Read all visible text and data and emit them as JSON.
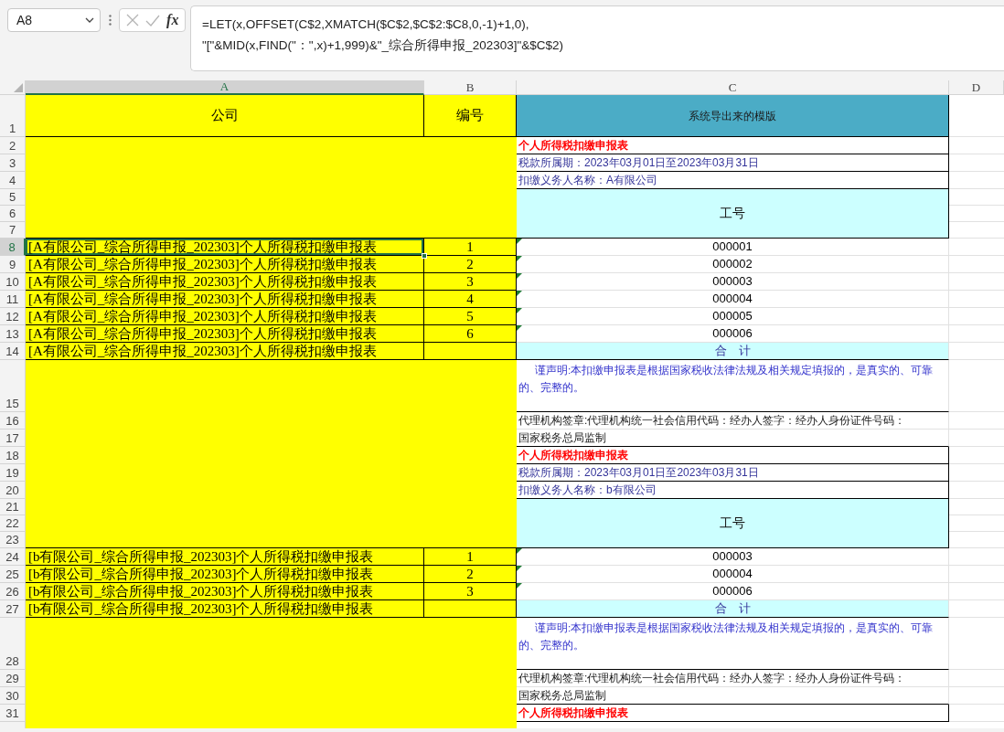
{
  "formula_bar": {
    "name_box": "A8",
    "buttons": [
      {
        "kind": "cancel",
        "disabled": true
      },
      {
        "kind": "enter",
        "disabled": true
      },
      {
        "kind": "function",
        "label": "fx",
        "disabled": false
      }
    ],
    "formula": "=LET(x,OFFSET(C$2,XMATCH($C$2,$C$2:$C8,0,-1)+1,0),\n\"[\"&MID(x,FIND(\"：\",x)+1,999)&\"_综合所得申报_202303]\"&$C$2)"
  },
  "columns": [
    {
      "label": "A",
      "selected": true
    },
    {
      "label": "B",
      "selected": false
    },
    {
      "label": "C",
      "selected": false
    },
    {
      "label": "D",
      "selected": false
    }
  ],
  "rows": [
    {
      "label": "1",
      "selected": false
    },
    {
      "label": "2",
      "selected": false
    },
    {
      "label": "3",
      "selected": false
    },
    {
      "label": "4",
      "selected": false
    },
    {
      "label": "5",
      "selected": false
    },
    {
      "label": "6",
      "selected": false
    },
    {
      "label": "7",
      "selected": false
    },
    {
      "label": "8",
      "selected": true
    },
    {
      "label": "9",
      "selected": false
    },
    {
      "label": "10",
      "selected": false
    },
    {
      "label": "11",
      "selected": false
    },
    {
      "label": "12",
      "selected": false
    },
    {
      "label": "13",
      "selected": false
    },
    {
      "label": "14",
      "selected": false
    },
    {
      "label": "15",
      "selected": false
    },
    {
      "label": "16",
      "selected": false
    },
    {
      "label": "17",
      "selected": false
    },
    {
      "label": "18",
      "selected": false
    },
    {
      "label": "19",
      "selected": false
    },
    {
      "label": "20",
      "selected": false
    },
    {
      "label": "21",
      "selected": false
    },
    {
      "label": "22",
      "selected": false
    },
    {
      "label": "23",
      "selected": false
    },
    {
      "label": "24",
      "selected": false
    },
    {
      "label": "25",
      "selected": false
    },
    {
      "label": "26",
      "selected": false
    },
    {
      "label": "27",
      "selected": false
    },
    {
      "label": "28",
      "selected": false
    },
    {
      "label": "29",
      "selected": false
    },
    {
      "label": "30",
      "selected": false
    },
    {
      "label": "31",
      "selected": false
    }
  ],
  "header": {
    "company": "公司",
    "number": "编号",
    "template": "系统导出来的模版"
  },
  "sections": [
    {
      "title": "个人所得税扣缴申报表",
      "period": "税款所属期：2023年03月01日至2023年03月31日",
      "withholder": "扣缴义务人名称：A有限公司",
      "id_header": "工号",
      "lines": [
        {
          "company": "[A有限公司_综合所得申报_202303]个人所得税扣缴申报表",
          "number": "1",
          "employee_id": "000001",
          "error_flag": true,
          "selected": true
        },
        {
          "company": "[A有限公司_综合所得申报_202303]个人所得税扣缴申报表",
          "number": "2",
          "employee_id": "000002",
          "error_flag": true,
          "selected": false
        },
        {
          "company": "[A有限公司_综合所得申报_202303]个人所得税扣缴申报表",
          "number": "3",
          "employee_id": "000003",
          "error_flag": true,
          "selected": false
        },
        {
          "company": "[A有限公司_综合所得申报_202303]个人所得税扣缴申报表",
          "number": "4",
          "employee_id": "000004",
          "error_flag": true,
          "selected": false
        },
        {
          "company": "[A有限公司_综合所得申报_202303]个人所得税扣缴申报表",
          "number": "5",
          "employee_id": "000005",
          "error_flag": true,
          "selected": false
        },
        {
          "company": "[A有限公司_综合所得申报_202303]个人所得税扣缴申报表",
          "number": "6",
          "employee_id": "000006",
          "error_flag": true,
          "selected": false
        }
      ],
      "total": {
        "company": "[A有限公司_综合所得申报_202303]个人所得税扣缴申报表",
        "label": "合　计",
        "selected": false
      },
      "statement": "谨声明:本扣缴申报表是根据国家税收法律法规及相关规定填报的，是真实的、可靠的、完整的。",
      "signature": "代理机构签章:代理机构统一社会信用代码：经办人签字：经办人身份证件号码：",
      "footer": "国家税务总局监制"
    },
    {
      "title": "个人所得税扣缴申报表",
      "period": "税款所属期：2023年03月01日至2023年03月31日",
      "withholder": "扣缴义务人名称：b有限公司",
      "id_header": "工号",
      "lines": [
        {
          "company": "[b有限公司_综合所得申报_202303]个人所得税扣缴申报表",
          "number": "1",
          "employee_id": "000003",
          "error_flag": true,
          "selected": false
        },
        {
          "company": "[b有限公司_综合所得申报_202303]个人所得税扣缴申报表",
          "number": "2",
          "employee_id": "000004",
          "error_flag": true,
          "selected": false
        },
        {
          "company": "[b有限公司_综合所得申报_202303]个人所得税扣缴申报表",
          "number": "3",
          "employee_id": "000006",
          "error_flag": true,
          "selected": false
        }
      ],
      "total": {
        "company": "[b有限公司_综合所得申报_202303]个人所得税扣缴申报表",
        "label": "合　计",
        "selected": false
      },
      "statement": "谨声明:本扣缴申报表是根据国家税收法律法规及相关规定填报的，是真实的、可靠的、完整的。",
      "signature": "代理机构签章:代理机构统一社会信用代码：经办人签字：经办人身份证件号码：",
      "footer": "国家税务总局监制"
    },
    {
      "title": "个人所得税扣缴申报表"
    }
  ]
}
